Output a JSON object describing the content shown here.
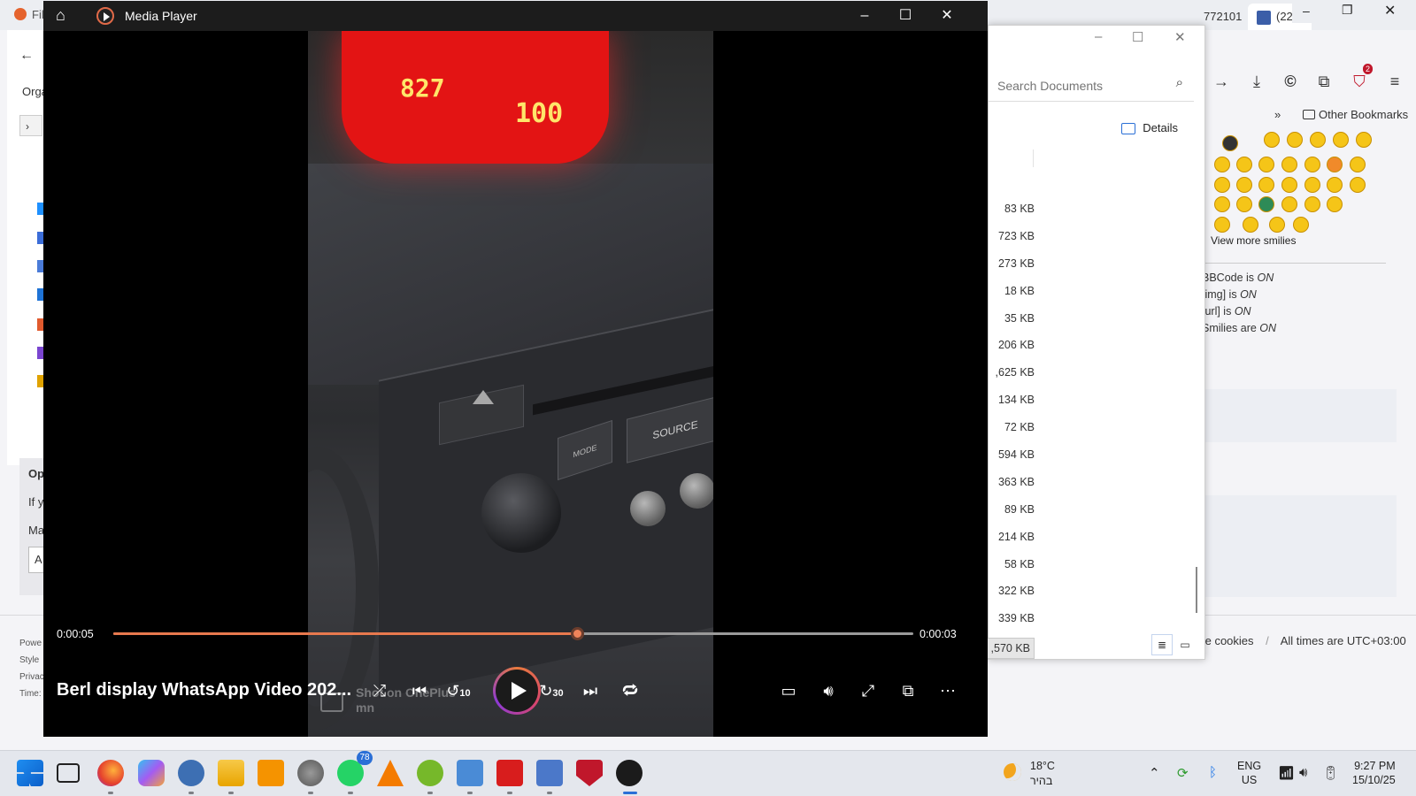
{
  "browser": {
    "tabs": [
      {
        "label": "772101"
      },
      {
        "label": "(22"
      }
    ],
    "bookmarks_label": "Other Bookmarks",
    "more_smilies": "View more smilies",
    "rules": [
      {
        "text": "BBCode is ",
        "state": "ON"
      },
      {
        "text": "[img] is ",
        "state": "ON"
      },
      {
        "text": "[url] is ",
        "state": "ON"
      },
      {
        "text": "Smilies are ",
        "state": "ON"
      }
    ],
    "footer_cookies": "te cookies",
    "footer_sep": "/",
    "footer_times": "All times are UTC+03:00",
    "partial_left": {
      "tab": "Fil",
      "org": "Orga",
      "op": "Op",
      "if": "If y",
      "ma": "Ma",
      "a": "A",
      "foot": [
        "Powe",
        "Style",
        "Privac",
        "Time:"
      ]
    },
    "ext_badge": "2"
  },
  "explorer": {
    "search_placeholder": "Search Documents",
    "details_label": "Details",
    "sizes": [
      "83 KB",
      "723 KB",
      "273 KB",
      "18 KB",
      "35 KB",
      "206 KB",
      ",625 KB",
      "134 KB",
      "72 KB",
      "594 KB",
      "363 KB",
      "89 KB",
      "214 KB",
      "58 KB",
      "322 KB",
      "339 KB",
      ",570 KB"
    ]
  },
  "player": {
    "app_title": "Media Player",
    "video_title": "Berl display WhatsApp Video 202...",
    "current_time": "0:00:05",
    "remaining_time": "0:00:03",
    "progress": 0.58,
    "skip_back": "10",
    "skip_forward": "30",
    "watermark_line1": "Shot on OnePlus",
    "watermark_line2": "mn",
    "video_display_text1": "827",
    "video_display_text2": "100",
    "video_button_mode": "MODE",
    "video_button_source": "SOURCE",
    "accent_color": "#e8794e"
  },
  "taskbar": {
    "whatsapp_badge": "78",
    "weather_temp": "18°C",
    "weather_place": "בהיר",
    "lang_line1": "ENG",
    "lang_line2": "US",
    "time": "9:27 PM",
    "date": "15/10/25"
  }
}
